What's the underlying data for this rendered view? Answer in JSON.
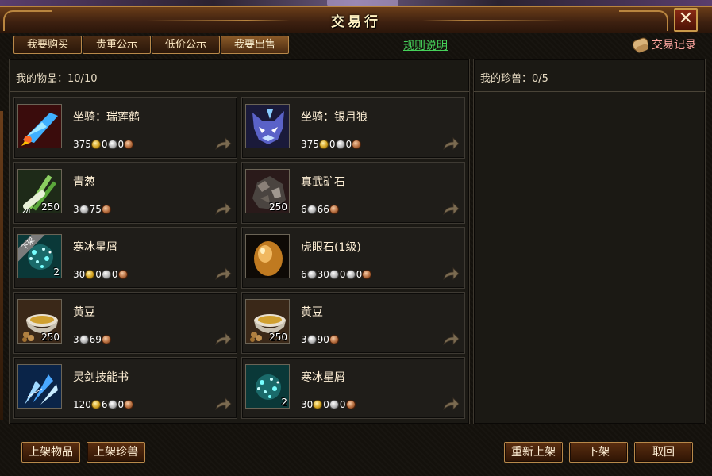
{
  "window": {
    "title": "交易行"
  },
  "tabs": [
    {
      "label": "我要购买"
    },
    {
      "label": "贵重公示"
    },
    {
      "label": "低价公示"
    },
    {
      "label": "我要出售"
    }
  ],
  "rules_link": "规则说明",
  "trade_log": "交易记录",
  "left_panel": {
    "label": "我的物品：",
    "count": "10/10"
  },
  "right_panel": {
    "label": "我的珍兽：",
    "count": "0/5"
  },
  "items": [
    {
      "name": "坐骑：瑞莲鹤",
      "qty": "",
      "price": [
        {
          "v": "375",
          "c": "gold"
        },
        {
          "v": "0",
          "c": "silver"
        },
        {
          "v": "0",
          "c": "copper"
        }
      ],
      "icon": "crane-mount-icon"
    },
    {
      "name": "坐骑：银月狼",
      "qty": "",
      "price": [
        {
          "v": "375",
          "c": "gold"
        },
        {
          "v": "0",
          "c": "silver"
        },
        {
          "v": "0",
          "c": "copper"
        }
      ],
      "icon": "wolf-mount-icon"
    },
    {
      "name": "青葱",
      "qty": "250",
      "price": [
        {
          "v": "3",
          "c": "silver"
        },
        {
          "v": "75",
          "c": "copper"
        }
      ],
      "icon": "scallion-icon"
    },
    {
      "name": "真武矿石",
      "qty": "250",
      "price": [
        {
          "v": "6",
          "c": "silver"
        },
        {
          "v": "66",
          "c": "copper"
        }
      ],
      "icon": "ore-icon"
    },
    {
      "name": "寒冰星屑",
      "qty": "2",
      "badge": "下架",
      "price": [
        {
          "v": "30",
          "c": "gold"
        },
        {
          "v": "0",
          "c": "silver"
        },
        {
          "v": "0",
          "c": "copper"
        }
      ],
      "icon": "ice-stardust-icon"
    },
    {
      "name": "虎眼石(1级)",
      "qty": "",
      "price": [
        {
          "v": "6",
          "c": "silver"
        },
        {
          "v": "30",
          "c": "silver"
        },
        {
          "v": "0",
          "c": "silver"
        },
        {
          "v": "0",
          "c": "copper"
        }
      ],
      "icon": "tiger-eye-stone-icon"
    },
    {
      "name": "黄豆",
      "qty": "250",
      "price": [
        {
          "v": "3",
          "c": "silver"
        },
        {
          "v": "69",
          "c": "copper"
        }
      ],
      "icon": "soybean-icon"
    },
    {
      "name": "黄豆",
      "qty": "250",
      "price": [
        {
          "v": "3",
          "c": "silver"
        },
        {
          "v": "90",
          "c": "copper"
        }
      ],
      "icon": "soybean-icon"
    },
    {
      "name": "灵剑技能书",
      "qty": "",
      "price": [
        {
          "v": "120",
          "c": "gold"
        },
        {
          "v": "6",
          "c": "silver"
        },
        {
          "v": "0",
          "c": "copper"
        }
      ],
      "icon": "sword-skill-book-icon"
    },
    {
      "name": "寒冰星屑",
      "qty": "2",
      "price": [
        {
          "v": "30",
          "c": "gold"
        },
        {
          "v": "0",
          "c": "silver"
        },
        {
          "v": "0",
          "c": "copper"
        }
      ],
      "icon": "ice-stardust-icon"
    }
  ],
  "bottom": {
    "list_item": "上架物品",
    "list_pet": "上架珍兽",
    "relist": "重新上架",
    "delist": "下架",
    "cancel": "取回"
  },
  "colors": {
    "accent_gold": "#b8894a",
    "link_green": "#46d25a",
    "log_pink": "#ffa6a0"
  }
}
